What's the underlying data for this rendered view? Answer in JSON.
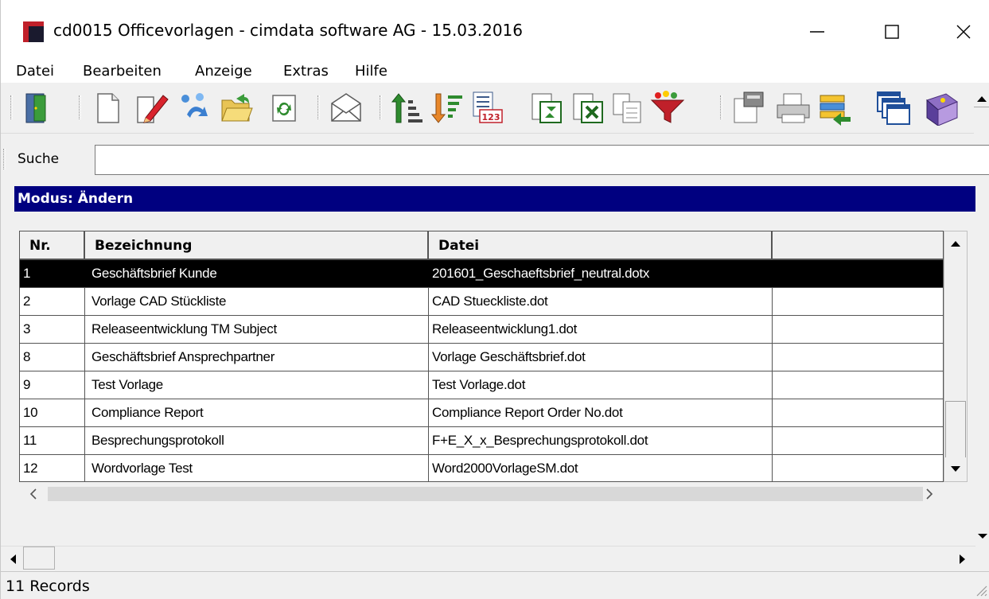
{
  "window": {
    "title": "cd0015 Officevorlagen - cimdata software AG - 15.03.2016",
    "minimize_symbol": "—",
    "maximize_symbol": "☐",
    "close_symbol": "✕"
  },
  "menu": [
    "Datei",
    "Bearbeiten",
    "Anzeige",
    "Extras",
    "Hilfe"
  ],
  "toolbar_icons": [
    "exit-door-icon",
    "new-document-icon",
    "edit-pencil-icon",
    "copy-molecule-icon",
    "open-folder-icon",
    "refresh-icon",
    "mail-envelope-icon",
    "sort-ascending-icon",
    "sort-descending-icon",
    "calendar-123-icon",
    "export-word-icon",
    "export-excel-icon",
    "duplicate-pages-icon",
    "filter-funnel-icon",
    "properties-icon",
    "print-icon",
    "transfer-icon",
    "windows-icon",
    "book-icon"
  ],
  "search": {
    "label": "Suche",
    "value": "",
    "placeholder": ""
  },
  "mode": {
    "text": "Modus: Ändern"
  },
  "table": {
    "columns": [
      "Nr.",
      "Bezeichnung",
      "Datei",
      ""
    ],
    "rows": [
      {
        "nr": "1",
        "bezeichnung": "Geschäftsbrief Kunde",
        "datei": "201601_Geschaeftsbrief_neutral.dotx",
        "selected": true
      },
      {
        "nr": "2",
        "bezeichnung": "Vorlage CAD Stückliste",
        "datei": "CAD Stueckliste.dot"
      },
      {
        "nr": "3",
        "bezeichnung": "Releaseentwicklung TM Subject",
        "datei": "Releaseentwicklung1.dot"
      },
      {
        "nr": "8",
        "bezeichnung": "Geschäftsbrief Ansprechpartner",
        "datei": "Vorlage Geschäftsbrief.dot"
      },
      {
        "nr": "9",
        "bezeichnung": "Test Vorlage",
        "datei": "Test Vorlage.dot"
      },
      {
        "nr": "10",
        "bezeichnung": "Compliance Report",
        "datei": "Compliance Report Order No.dot"
      },
      {
        "nr": "11",
        "bezeichnung": "Besprechungsprotokoll",
        "datei": "F+E_X_x_Besprechungsprotokoll.dot"
      },
      {
        "nr": "12",
        "bezeichnung": "Wordvorlage Test",
        "datei": "Word2000VorlageSM.dot"
      }
    ]
  },
  "status": {
    "text": "11 Records"
  },
  "colors": {
    "mode_bar": "#000080",
    "selected_row": "#000000",
    "app_icon_red": "#c0202a"
  }
}
